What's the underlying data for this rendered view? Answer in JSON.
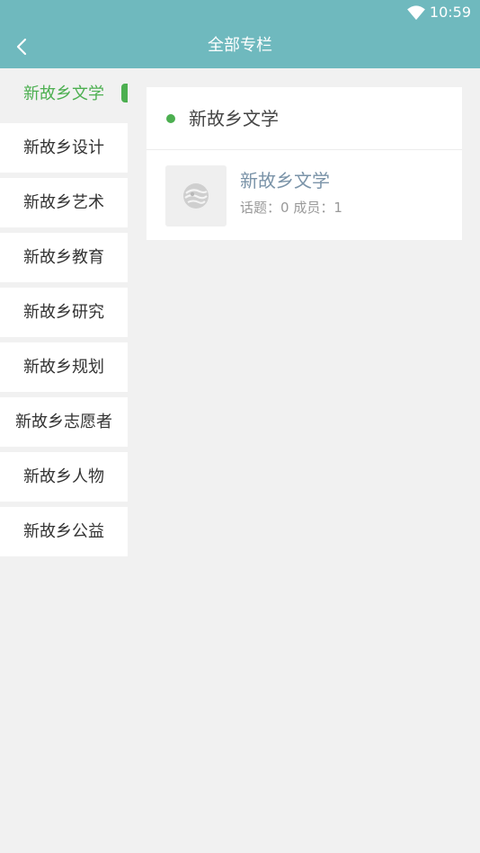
{
  "status_bar": {
    "time": "10:59",
    "wifi_icon": "wifi-icon"
  },
  "app_bar": {
    "title": "全部专栏",
    "back_icon": "back-arrow-icon"
  },
  "sidebar": {
    "items": [
      {
        "label": "新故乡文学",
        "active": true
      },
      {
        "label": "新故乡设计",
        "active": false
      },
      {
        "label": "新故乡艺术",
        "active": false
      },
      {
        "label": "新故乡教育",
        "active": false
      },
      {
        "label": "新故乡研究",
        "active": false
      },
      {
        "label": "新故乡规划",
        "active": false
      },
      {
        "label": "新故乡志愿者",
        "active": false
      },
      {
        "label": "新故乡人物",
        "active": false
      },
      {
        "label": "新故乡公益",
        "active": false
      }
    ]
  },
  "panel": {
    "heading": "新故乡文学",
    "card": {
      "name": "新故乡文学",
      "topics_label": "话题：",
      "topics": "0",
      "members_label": "成员：",
      "members": "1"
    }
  },
  "colors": {
    "accent": "#6fb9be",
    "active": "#4caf50",
    "background": "#f1f1f1"
  }
}
